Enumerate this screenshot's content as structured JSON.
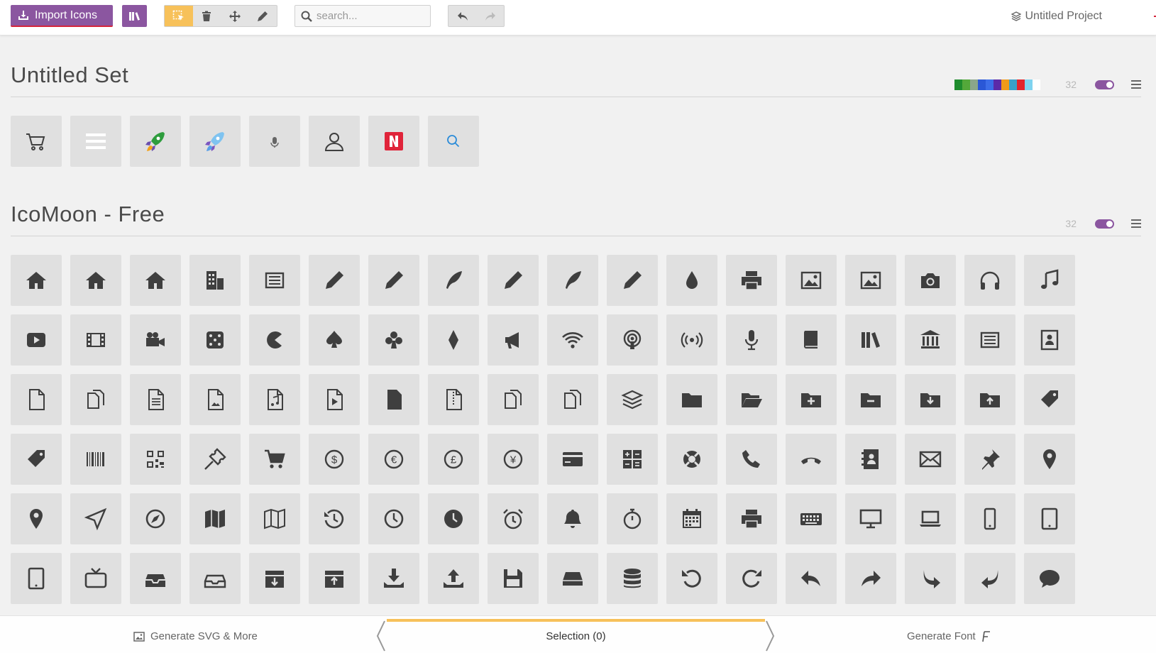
{
  "toolbar": {
    "import_label": "Import Icons",
    "search_placeholder": "search...",
    "project_name": "Untitled Project"
  },
  "sets": [
    {
      "title": "Untitled Set",
      "count": "32",
      "palette": [
        "#1e8c2d",
        "#53a83a",
        "#8aa68a",
        "#2a57d6",
        "#3c6de8",
        "#5b2aa8",
        "#ef9a1a",
        "#3aa0c8",
        "#e2242c",
        "#7fd3f0",
        "#ffffff"
      ],
      "icons": [
        "cart-icon",
        "menu-icon",
        "rocket-green-icon",
        "rocket-blue-icon",
        "microphone-small-icon",
        "user-icon",
        "netflix-n-icon",
        "search-icon"
      ]
    },
    {
      "title": "IcoMoon - Free",
      "count": "32",
      "icons": [
        "home-icon",
        "home2-icon",
        "home3-icon",
        "office-icon",
        "newspaper-icon",
        "pencil-icon",
        "pencil2-icon",
        "quill-icon",
        "pen-icon",
        "blog-icon",
        "eyedropper-icon",
        "droplet-icon",
        "paint-roller-icon",
        "image-icon",
        "images-icon",
        "camera-icon",
        "headphones-icon",
        "music-icon",
        "play-icon",
        "film-icon",
        "video-camera-icon",
        "dice-icon",
        "pacman-icon",
        "spades-icon",
        "clubs-icon",
        "diamonds-icon",
        "bullhorn-icon",
        "wifi-icon",
        "podcast-icon",
        "feed-icon",
        "mic-icon",
        "book-icon",
        "books-icon",
        "library-icon",
        "file-text-icon",
        "profile-icon",
        "file-empty-icon",
        "files-empty-icon",
        "file-text2-icon",
        "file-picture-icon",
        "file-music-icon",
        "file-play-icon",
        "file-video-icon",
        "file-zip-icon",
        "copy-icon",
        "paste-icon",
        "stack-icon",
        "folder-icon",
        "folder-open-icon",
        "folder-plus-icon",
        "folder-minus-icon",
        "folder-download-icon",
        "folder-upload-icon",
        "price-tag-icon",
        "price-tags-icon",
        "barcode-icon",
        "qrcode-icon",
        "ticket-icon",
        "cart2-icon",
        "coin-dollar-icon",
        "coin-euro-icon",
        "coin-pound-icon",
        "coin-yen-icon",
        "credit-card-icon",
        "calculator-icon",
        "lifebuoy-icon",
        "phone-icon",
        "phone-hang-up-icon",
        "address-book-icon",
        "envelop-icon",
        "pushpin-icon",
        "location-icon",
        "location2-icon",
        "compass-icon",
        "compass2-icon",
        "map-icon",
        "map2-icon",
        "history-icon",
        "clock-icon",
        "clock2-icon",
        "alarm-icon",
        "bell-icon",
        "stopwatch-icon",
        "calendar-icon",
        "printer-icon",
        "keyboard-icon",
        "display-icon",
        "laptop-icon",
        "mobile-icon",
        "mobile2-icon",
        "tablet-icon",
        "tv-icon",
        "drawer-icon",
        "drawer2-icon",
        "box-add-icon",
        "box-remove-icon",
        "download-icon",
        "upload-icon",
        "floppy-disk-icon",
        "drive-icon",
        "database-icon",
        "undo-icon",
        "redo-icon",
        "undo2-icon",
        "redo2-icon",
        "forward-icon",
        "reply-icon",
        "bubble-icon"
      ]
    }
  ],
  "bottombar": {
    "generate_svg_label": "Generate SVG & More",
    "selection_label": "Selection (0)",
    "generate_font_label": "Generate Font"
  }
}
